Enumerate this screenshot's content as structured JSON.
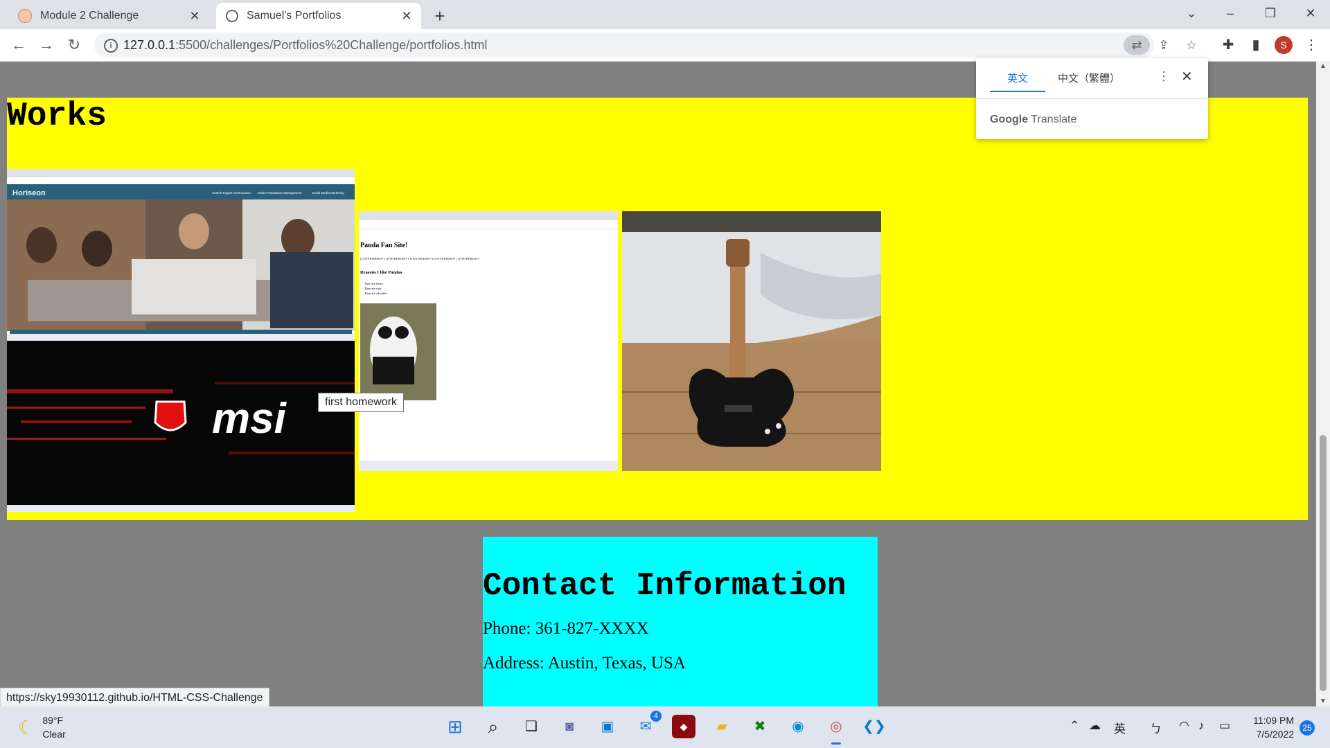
{
  "browser": {
    "tabs": [
      {
        "title": "Module 2 Challenge",
        "active": false
      },
      {
        "title": "Samuel's Portfolios",
        "active": true
      }
    ],
    "url_host": "127.0.0.1",
    "url_rest": ":5500/challenges/Portfolios%20Challenge/portfolios.html",
    "profile_initial": "S"
  },
  "translate_popup": {
    "lang_source": "英文",
    "lang_target": "中文（繁體）",
    "brand_google": "Google",
    "brand_translate": "Translate"
  },
  "page": {
    "works_heading": "Works",
    "tooltip": "first homework",
    "screenshot1": {
      "brand": "Horiseon",
      "nav": [
        "Search Engine Optimization",
        "Online Reputation Management",
        "Social Media Marketing"
      ]
    },
    "screenshot2": {
      "logo": "msi"
    },
    "screenshot3": {
      "title": "Panda Fan Site!",
      "line": "I LOVE PANDAS!!! I LOVE PANDAS!!! I LOVE PANDAS!!! I LOVE PANDAS!!! I LOVE PANDAS!!!",
      "subheading": "Reasons I like Pandas",
      "reasons": [
        "They are fuzzy",
        "They are cute",
        "They are adorable"
      ]
    },
    "contact": {
      "heading": "Contact Information",
      "phone": "Phone: 361-827-XXXX",
      "address": "Address: Austin, Texas, USA"
    },
    "status_url": "https://sky19930112.github.io/HTML-CSS-Challenge"
  },
  "taskbar": {
    "temp": "89°F",
    "condition": "Clear",
    "mail_badge": "4",
    "ime": "英",
    "ime2": "ㄅ",
    "time": "11:09 PM",
    "date": "7/5/2022",
    "notifications": "25"
  },
  "colors": {
    "works_bg": "#ffff00",
    "contact_bg": "#00ffff",
    "page_bg": "#808080"
  }
}
